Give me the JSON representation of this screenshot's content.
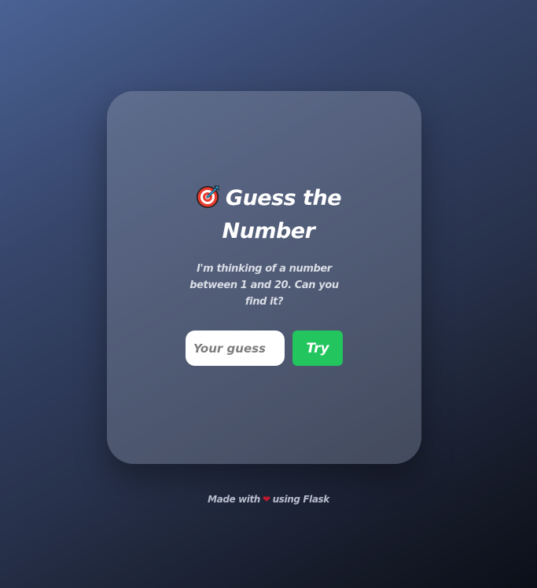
{
  "card": {
    "title_line1": "Guess the",
    "title_line2": "Number",
    "title_icon": "target-icon",
    "subtitle": "I'm thinking of a number between 1 and 20. Can you find it?"
  },
  "form": {
    "guess_placeholder": "Your guess",
    "guess_value": "",
    "submit_label": "Try"
  },
  "footer": {
    "prefix": "Made with",
    "icon": "heart-icon",
    "suffix": "using Flask"
  },
  "colors": {
    "accent": "#22c55e",
    "heart": "#c0182c"
  }
}
